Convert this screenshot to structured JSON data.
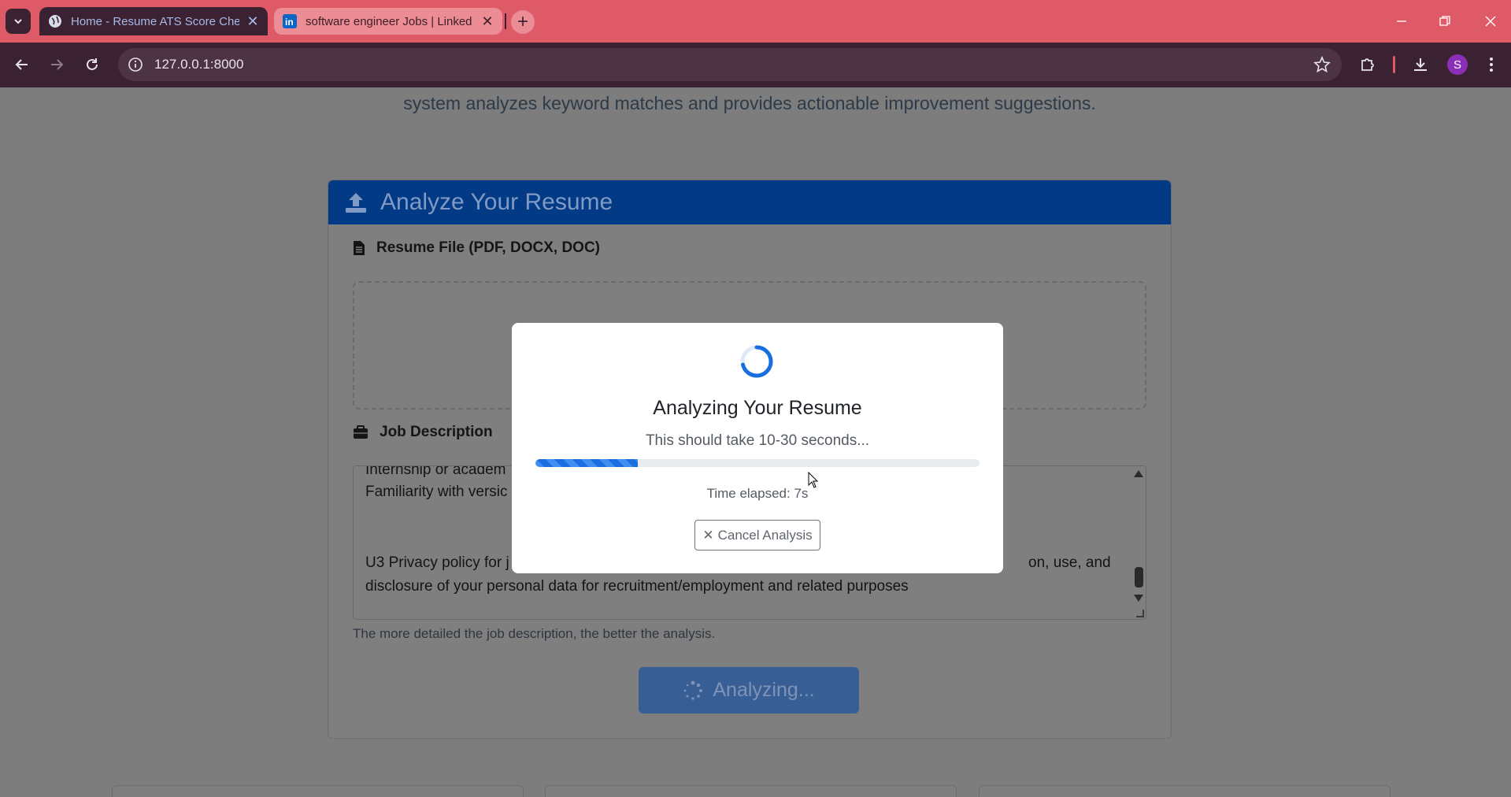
{
  "browser": {
    "tabs": [
      {
        "title": "Home - Resume ATS Score Che",
        "active": true,
        "icon": "globe-icon"
      },
      {
        "title": "software engineer Jobs | Linked",
        "active": false,
        "icon": "linkedin-icon"
      }
    ],
    "url": "127.0.0.1:8000",
    "profile_initial": "S",
    "colors": {
      "tabbar": "#de5a66",
      "toolbar": "#3a2233",
      "profile": "#8b2fb8"
    }
  },
  "page": {
    "subtitle": "system analyzes keyword matches and provides actionable improvement suggestions.",
    "card_title": "Analyze Your Resume",
    "resume_label": "Resume File (PDF, DOCX, DOC)",
    "job_label": "Job Description",
    "job_text_lines": [
      "Internship or academ",
      "Familiarity with versic",
      "",
      "U3 Privacy policy for j",
      "disclosure of your personal data for recruitment/employment and related purposes"
    ],
    "job_text_right_fragment": "on, use, and",
    "help_text": "The more detailed the job description, the better the analysis.",
    "analyze_button": "Analyzing...",
    "colors": {
      "header": "#033a85",
      "button": "#385e96"
    }
  },
  "modal": {
    "title": "Analyzing Your Resume",
    "subtitle": "This should take 10-30 seconds...",
    "progress_percent": 23,
    "elapsed": "Time elapsed: 7s",
    "cancel_label": "Cancel Analysis",
    "colors": {
      "progress": "#1a6fe0",
      "spinner": "#1a6fe0"
    }
  }
}
